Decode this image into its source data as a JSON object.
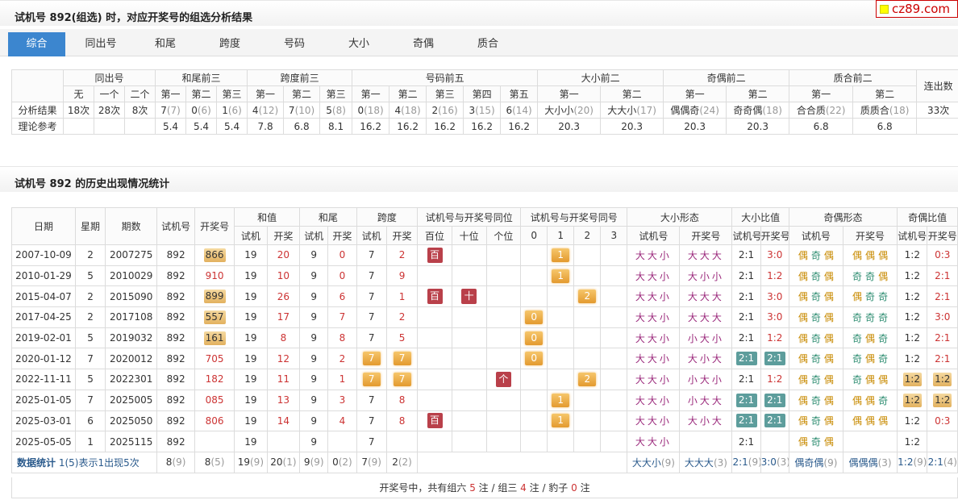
{
  "section1_title": "试机号 892(组选) 时，对应开奖号的组选分析结果",
  "section2_title": "试机号 892 的历史出现情况统计",
  "logo_text": "cz89.com",
  "tabs": [
    "综合",
    "同出号",
    "和尾",
    "跨度",
    "号码",
    "大小",
    "奇偶",
    "质合"
  ],
  "analysis": {
    "group_headers": [
      "同出号",
      "和尾前三",
      "跨度前三",
      "号码前五",
      "大小前二",
      "奇偶前二",
      "质合前二",
      "连出数"
    ],
    "sub_headers": [
      "无",
      "一个",
      "二个",
      "第一",
      "第二",
      "第三",
      "第一",
      "第二",
      "第三",
      "第一",
      "第二",
      "第三",
      "第四",
      "第五",
      "第一",
      "第二",
      "第一",
      "第二",
      "第一",
      "第二"
    ],
    "row1_label": "分析结果",
    "row1": [
      [
        "18次",
        ""
      ],
      [
        "28次",
        ""
      ],
      [
        "8次",
        ""
      ],
      [
        "7",
        "(7)"
      ],
      [
        "0",
        "(6)"
      ],
      [
        "1",
        "(6)"
      ],
      [
        "4",
        "(12)"
      ],
      [
        "7",
        "(10)"
      ],
      [
        "5",
        "(8)"
      ],
      [
        "0",
        "(18)"
      ],
      [
        "4",
        "(18)"
      ],
      [
        "2",
        "(16)"
      ],
      [
        "3",
        "(15)"
      ],
      [
        "6",
        "(14)"
      ],
      [
        "大小小",
        "(20)"
      ],
      [
        "大大小",
        "(17)"
      ],
      [
        "偶偶奇",
        "(24)"
      ],
      [
        "奇奇偶",
        "(18)"
      ],
      [
        "合合质",
        "(22)"
      ],
      [
        "质质合",
        "(18)"
      ],
      [
        "33次",
        ""
      ]
    ],
    "row2_label": "理论参考",
    "row2": [
      "",
      "",
      "",
      "5.4",
      "5.4",
      "5.4",
      "7.8",
      "6.8",
      "8.1",
      "16.2",
      "16.2",
      "16.2",
      "16.2",
      "16.2",
      "20.3",
      "20.3",
      "20.3",
      "20.3",
      "6.8",
      "6.8",
      ""
    ]
  },
  "history": {
    "group_headers": [
      "日期",
      "星期",
      "期数",
      "试机号",
      "开奖号",
      "和值",
      "和尾",
      "跨度",
      "试机号与开奖号同位",
      "试机号与开奖号同号",
      "大小形态",
      "大小比值",
      "奇偶形态",
      "奇偶比值"
    ],
    "sub_headers": [
      "试机",
      "开奖",
      "试机",
      "开奖",
      "试机",
      "开奖",
      "百位",
      "十位",
      "个位",
      "0",
      "1",
      "2",
      "3",
      "试机号",
      "开奖号",
      "试机号",
      "开奖号",
      "试机号",
      "开奖号",
      "试机号",
      "开奖号"
    ],
    "rows": [
      {
        "date": "2007-10-09",
        "week": "2",
        "issue": "2007275",
        "test": "892",
        "draw": "866",
        "draw_hl": true,
        "sum_t": "19",
        "sum_d": "20",
        "tail_t": "9",
        "tail_d": "0",
        "span_t": "7",
        "span_d": "2",
        "bai": "百",
        "shi": "",
        "ge": "",
        "n0": "",
        "n1": "1",
        "n2": "",
        "n3": "",
        "szt": "大大小",
        "szd": "大大大",
        "zrt": "2:1",
        "zrt_hl": false,
        "zrd": "3:0",
        "zrd_hl": false,
        "oet": [
          "偶",
          "奇",
          "偶"
        ],
        "oed": [
          "偶",
          "偶",
          "偶"
        ],
        "oret": "1:2",
        "oret_hl": false,
        "ored": "0:3",
        "ored_hl": false
      },
      {
        "date": "2010-01-29",
        "week": "5",
        "issue": "2010029",
        "test": "892",
        "draw": "910",
        "draw_hl": false,
        "sum_t": "19",
        "sum_d": "10",
        "tail_t": "9",
        "tail_d": "0",
        "span_t": "7",
        "span_d": "9",
        "bai": "",
        "shi": "",
        "ge": "",
        "n0": "",
        "n1": "1",
        "n2": "",
        "n3": "",
        "szt": "大大小",
        "szd": "大小小",
        "zrt": "2:1",
        "zrt_hl": false,
        "zrd": "1:2",
        "zrd_hl": false,
        "oet": [
          "偶",
          "奇",
          "偶"
        ],
        "oed": [
          "奇",
          "奇",
          "偶"
        ],
        "oret": "1:2",
        "oret_hl": false,
        "ored": "2:1",
        "ored_hl": false
      },
      {
        "date": "2015-04-07",
        "week": "2",
        "issue": "2015090",
        "test": "892",
        "draw": "899",
        "draw_hl": true,
        "sum_t": "19",
        "sum_d": "26",
        "tail_t": "9",
        "tail_d": "6",
        "span_t": "7",
        "span_d": "1",
        "bai": "百",
        "shi": "十",
        "ge": "",
        "n0": "",
        "n1": "",
        "n2": "2",
        "n3": "",
        "szt": "大大小",
        "szd": "大大大",
        "zrt": "2:1",
        "zrt_hl": false,
        "zrd": "3:0",
        "zrd_hl": false,
        "oet": [
          "偶",
          "奇",
          "偶"
        ],
        "oed": [
          "偶",
          "奇",
          "奇"
        ],
        "oret": "1:2",
        "oret_hl": false,
        "ored": "2:1",
        "ored_hl": false
      },
      {
        "date": "2017-04-25",
        "week": "2",
        "issue": "2017108",
        "test": "892",
        "draw": "557",
        "draw_hl": true,
        "sum_t": "19",
        "sum_d": "17",
        "tail_t": "9",
        "tail_d": "7",
        "span_t": "7",
        "span_d": "2",
        "bai": "",
        "shi": "",
        "ge": "",
        "n0": "0",
        "n1": "",
        "n2": "",
        "n3": "",
        "szt": "大大小",
        "szd": "大大大",
        "zrt": "2:1",
        "zrt_hl": false,
        "zrd": "3:0",
        "zrd_hl": false,
        "oet": [
          "偶",
          "奇",
          "偶"
        ],
        "oed": [
          "奇",
          "奇",
          "奇"
        ],
        "oret": "1:2",
        "oret_hl": false,
        "ored": "3:0",
        "ored_hl": false
      },
      {
        "date": "2019-02-01",
        "week": "5",
        "issue": "2019032",
        "test": "892",
        "draw": "161",
        "draw_hl": true,
        "sum_t": "19",
        "sum_d": "8",
        "tail_t": "9",
        "tail_d": "8",
        "span_t": "7",
        "span_d": "5",
        "bai": "",
        "shi": "",
        "ge": "",
        "n0": "0",
        "n1": "",
        "n2": "",
        "n3": "",
        "szt": "大大小",
        "szd": "小大小",
        "zrt": "2:1",
        "zrt_hl": false,
        "zrd": "1:2",
        "zrd_hl": false,
        "oet": [
          "偶",
          "奇",
          "偶"
        ],
        "oed": [
          "奇",
          "偶",
          "奇"
        ],
        "oret": "1:2",
        "oret_hl": false,
        "ored": "2:1",
        "ored_hl": false
      },
      {
        "date": "2020-01-12",
        "week": "7",
        "issue": "2020012",
        "test": "892",
        "draw": "705",
        "draw_hl": false,
        "sum_t": "19",
        "sum_d": "12",
        "tail_t": "9",
        "tail_d": "2",
        "span_t": "7",
        "span_d": "7",
        "span_hl": true,
        "bai": "",
        "shi": "",
        "ge": "",
        "n0": "0",
        "n1": "",
        "n2": "",
        "n3": "",
        "szt": "大大小",
        "szd": "大小大",
        "zrt": "2:1",
        "zrt_hl": true,
        "zrd": "2:1",
        "zrd_hl": true,
        "oet": [
          "偶",
          "奇",
          "偶"
        ],
        "oed": [
          "奇",
          "偶",
          "奇"
        ],
        "oret": "1:2",
        "oret_hl": false,
        "ored": "2:1",
        "ored_hl": false
      },
      {
        "date": "2022-11-11",
        "week": "5",
        "issue": "2022301",
        "test": "892",
        "draw": "182",
        "draw_hl": false,
        "sum_t": "19",
        "sum_d": "11",
        "tail_t": "9",
        "tail_d": "1",
        "span_t": "7",
        "span_d": "7",
        "span_hl": true,
        "bai": "",
        "shi": "",
        "ge": "个",
        "n0": "",
        "n1": "",
        "n2": "2",
        "n3": "",
        "szt": "大大小",
        "szd": "小大小",
        "zrt": "2:1",
        "zrt_hl": false,
        "zrd": "1:2",
        "zrd_hl": false,
        "oet": [
          "偶",
          "奇",
          "偶"
        ],
        "oed": [
          "奇",
          "偶",
          "偶"
        ],
        "oret": "1:2",
        "oret_hl": true,
        "ored": "1:2",
        "ored_hl": true
      },
      {
        "date": "2025-01-05",
        "week": "7",
        "issue": "2025005",
        "test": "892",
        "draw": "085",
        "draw_hl": false,
        "sum_t": "19",
        "sum_d": "13",
        "tail_t": "9",
        "tail_d": "3",
        "span_t": "7",
        "span_d": "8",
        "bai": "",
        "shi": "",
        "ge": "",
        "n0": "",
        "n1": "1",
        "n2": "",
        "n3": "",
        "szt": "大大小",
        "szd": "小大大",
        "zrt": "2:1",
        "zrt_hl": true,
        "zrd": "2:1",
        "zrd_hl": true,
        "oet": [
          "偶",
          "奇",
          "偶"
        ],
        "oed": [
          "偶",
          "偶",
          "奇"
        ],
        "oret": "1:2",
        "oret_hl": true,
        "ored": "1:2",
        "ored_hl": true
      },
      {
        "date": "2025-03-01",
        "week": "6",
        "issue": "2025050",
        "test": "892",
        "draw": "806",
        "draw_hl": false,
        "sum_t": "19",
        "sum_d": "14",
        "tail_t": "9",
        "tail_d": "4",
        "span_t": "7",
        "span_d": "8",
        "bai": "百",
        "shi": "",
        "ge": "",
        "n0": "",
        "n1": "1",
        "n2": "",
        "n3": "",
        "szt": "大大小",
        "szd": "大小大",
        "zrt": "2:1",
        "zrt_hl": true,
        "zrd": "2:1",
        "zrd_hl": true,
        "oet": [
          "偶",
          "奇",
          "偶"
        ],
        "oed": [
          "偶",
          "偶",
          "偶"
        ],
        "oret": "1:2",
        "oret_hl": false,
        "ored": "0:3",
        "ored_hl": false
      },
      {
        "date": "2025-05-05",
        "week": "1",
        "issue": "2025115",
        "test": "892",
        "draw": "",
        "draw_hl": false,
        "sum_t": "19",
        "sum_d": "",
        "tail_t": "9",
        "tail_d": "",
        "span_t": "7",
        "span_d": "",
        "bai": "",
        "shi": "",
        "ge": "",
        "n0": "",
        "n1": "",
        "n2": "",
        "n3": "",
        "szt": "大大小",
        "szd": "",
        "zrt": "2:1",
        "zrt_hl": false,
        "zrd": "",
        "zrd_hl": false,
        "oet": [
          "偶",
          "奇",
          "偶"
        ],
        "oed": [],
        "oret": "1:2",
        "oret_hl": false,
        "ored": "",
        "ored_hl": false
      }
    ],
    "stats": {
      "label": "数据统计",
      "desc": "1(5)表示1出现5次",
      "test": [
        "8",
        "(9)"
      ],
      "draw": [
        "8",
        "(5)"
      ],
      "sum_t": [
        "19",
        "(9)"
      ],
      "sum_d": [
        "20",
        "(1)"
      ],
      "tail_t": [
        "9",
        "(9)"
      ],
      "tail_d": [
        "0",
        "(2)"
      ],
      "span_t": [
        "7",
        "(9)"
      ],
      "span_d": [
        "2",
        "(2)"
      ],
      "szt": [
        "大大小",
        "(9)"
      ],
      "szd": [
        "大大大",
        "(3)"
      ],
      "zrt": [
        "2:1",
        "(9)"
      ],
      "zrd": [
        "3:0",
        "(3)"
      ],
      "oet": [
        "偶奇偶",
        "(9)"
      ],
      "oed": [
        "偶偶偶",
        "(3)"
      ],
      "oret": [
        "1:2",
        "(9)"
      ],
      "ored": [
        "2:1",
        "(4)"
      ]
    }
  },
  "footer": {
    "p1": "开奖号中，共有组六 ",
    "c6": "5",
    "p2": " 注 / 组三 ",
    "c3": "4",
    "p3": " 注 / 豹子 ",
    "cb": "0",
    "p4": " 注"
  }
}
